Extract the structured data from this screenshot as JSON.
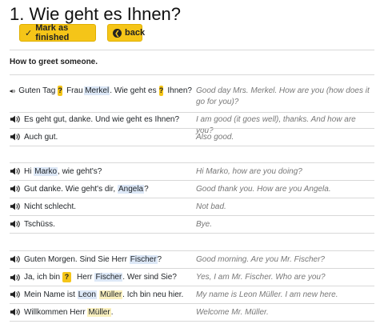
{
  "title": "1. Wie geht es Ihnen?",
  "buttons": {
    "finished": "Mark as finished",
    "back": "back"
  },
  "description": "How to greet someone.",
  "q": "?",
  "rows": [
    {
      "de": {
        "a": "Guten Tag",
        "b": "Frau",
        "c": "Merkel",
        "d": ". Wie geht es",
        "e": "Ihnen?"
      },
      "en": "Good day Mrs. Merkel. How are you (how does it go for you)?"
    },
    {
      "de": {
        "a": "Es geht gut, danke. Und wie geht es Ihnen?"
      },
      "en": "I am good (it goes well), thanks. And how are you?"
    },
    {
      "de": {
        "a": "Auch gut."
      },
      "en": "Also good."
    },
    {
      "de": {
        "a": "Hi ",
        "b": "Marko",
        "c": ", wie geht's?"
      },
      "en": "Hi Marko, how are you doing?"
    },
    {
      "de": {
        "a": "Gut danke. Wie geht's dir, ",
        "b": "Angela",
        "c": "?"
      },
      "en": "Good thank you. How are you Angela."
    },
    {
      "de": {
        "a": "Nicht schlecht."
      },
      "en": "Not bad."
    },
    {
      "de": {
        "a": "Tschüss."
      },
      "en": "Bye."
    },
    {
      "de": {
        "a": "Guten Morgen. Sind Sie Herr ",
        "b": "Fischer",
        "c": "?"
      },
      "en": "Good morning. Are you Mr. Fischer?"
    },
    {
      "de": {
        "a": "Ja, ich bin",
        "b": "Herr",
        "c": "Fischer",
        "d": ". Wer sind Sie?"
      },
      "en": "Yes, I am Mr. Fischer. Who are you?"
    },
    {
      "de": {
        "a": "Mein Name ist ",
        "b": "Leon",
        "c": "Müller",
        "d": ". Ich bin neu hier."
      },
      "en": "My name is Leon Müller. I am new here."
    },
    {
      "de": {
        "a": "Willkommen Herr ",
        "b": "Müller",
        "c": "."
      },
      "en": "Welcome Mr. Müller."
    }
  ]
}
